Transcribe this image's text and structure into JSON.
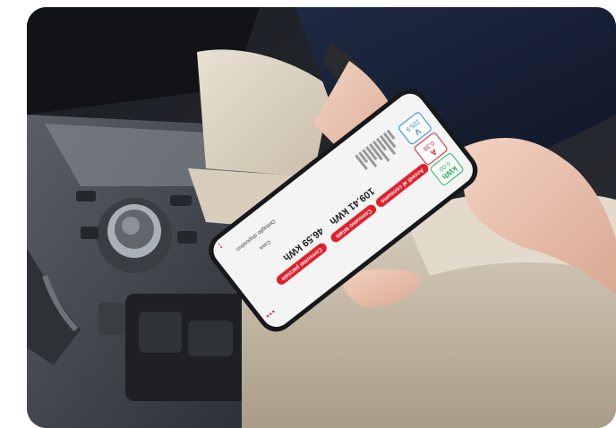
{
  "photo": {
    "subject": "hand-holding-phone-in-car"
  },
  "app": {
    "cards": [
      {
        "value": "0.00",
        "unit": "kWh",
        "color": "#23b35a"
      },
      {
        "value": "0.38",
        "unit": "A",
        "color": "#e21f2a"
      },
      {
        "value": "225.9",
        "unit": "V",
        "color": "#2388e0"
      }
    ],
    "pill_realtime": "Accedi al consumo",
    "total_label": "Consumo totale",
    "total_value": "109.41 kWh",
    "partial_label": "Consumo parziale",
    "partial_value": "46.59 kWh",
    "home_label": "Casa",
    "device_label": "Dettaglio dispositivo",
    "menu_icon": "dots-icon",
    "back_icon": "arrow-icon"
  },
  "colors": {
    "accent": "#e21f2a",
    "green": "#23b35a",
    "blue": "#2388e0"
  }
}
